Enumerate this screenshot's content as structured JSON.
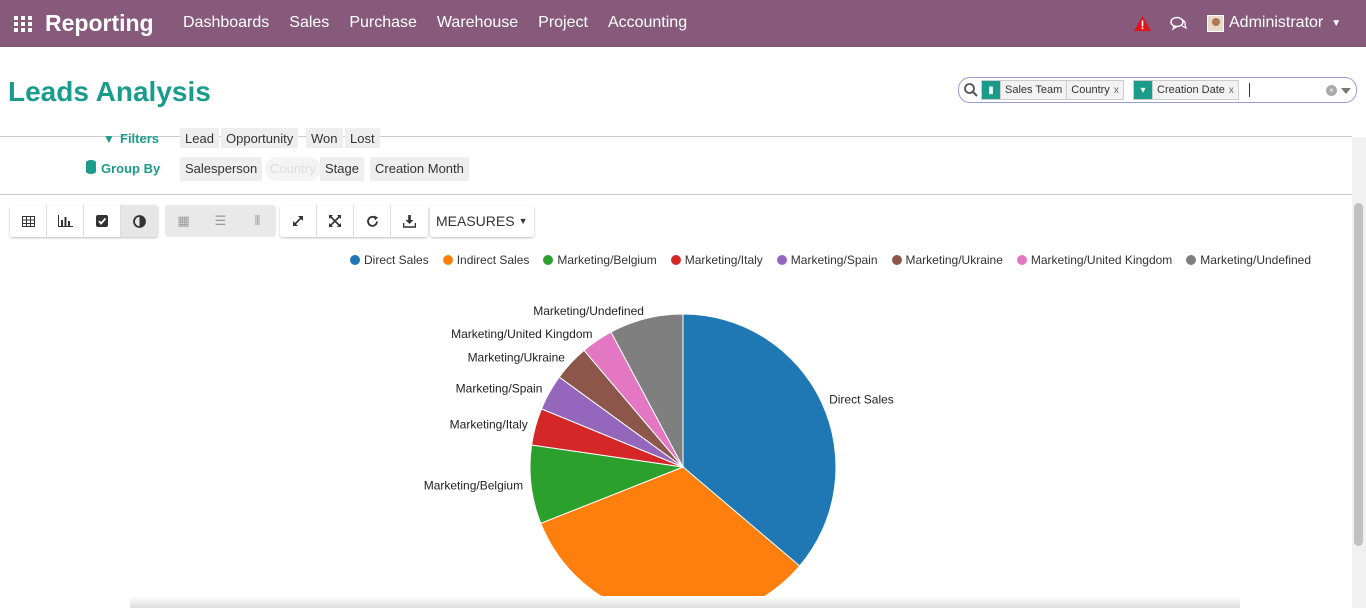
{
  "topbar": {
    "app_title": "Reporting",
    "menu": [
      "Dashboards",
      "Sales",
      "Purchase",
      "Warehouse",
      "Project",
      "Accounting"
    ],
    "user_name": "Administrator",
    "bg_color": "#875a7b",
    "icons": [
      "apps-grid-icon",
      "warning-icon",
      "chat-icon"
    ]
  },
  "page": {
    "title": "Leads Analysis"
  },
  "search": {
    "facets": [
      {
        "icon": "group-by-icon",
        "values": [
          "Sales Team",
          "Country"
        ]
      },
      {
        "icon": "date-icon",
        "values": [
          "Creation Date"
        ]
      }
    ],
    "input_value": "",
    "remove_symbol": "x"
  },
  "filters": {
    "label": "Filters",
    "items": [
      "Lead",
      "Opportunity",
      "Won",
      "Lost"
    ]
  },
  "groupby": {
    "label": "Group By",
    "items": [
      "Salesperson",
      "Country",
      "Stage",
      "Creation Month"
    ]
  },
  "toolbar": {
    "view_buttons": [
      "table-icon",
      "bar-chart-icon",
      "checkbox-icon",
      "pie-chart-icon"
    ],
    "layout_buttons": [
      "grid-icon",
      "list-icon",
      "columns-icon"
    ],
    "action_buttons": [
      "expand-icon",
      "fullscreen-icon",
      "refresh-icon",
      "download-icon"
    ],
    "measures_label": "MEASURES"
  },
  "chart_data": {
    "type": "pie",
    "categories": [
      "Direct Sales",
      "Indirect Sales",
      "Marketing/Belgium",
      "Marketing/Italy",
      "Marketing/Spain",
      "Marketing/Ukraine",
      "Marketing/United Kingdom",
      "Marketing/Undefined"
    ],
    "values": [
      36.2,
      32.8,
      8.3,
      3.9,
      3.8,
      3.8,
      3.4,
      7.8
    ],
    "colors": [
      "#1f77b4",
      "#ff7f0e",
      "#2ca02c",
      "#d62728",
      "#9467bd",
      "#8c564b",
      "#e377c2",
      "#7f7f7f"
    ],
    "slice_labels": [
      "Direct Sales",
      "",
      "Marketing/Belgium",
      "Marketing/Italy",
      "Marketing/Spain",
      "Marketing/Ukraine",
      "Marketing/United Kingdom",
      "Marketing/Undefined"
    ],
    "legend_placement": "top"
  }
}
